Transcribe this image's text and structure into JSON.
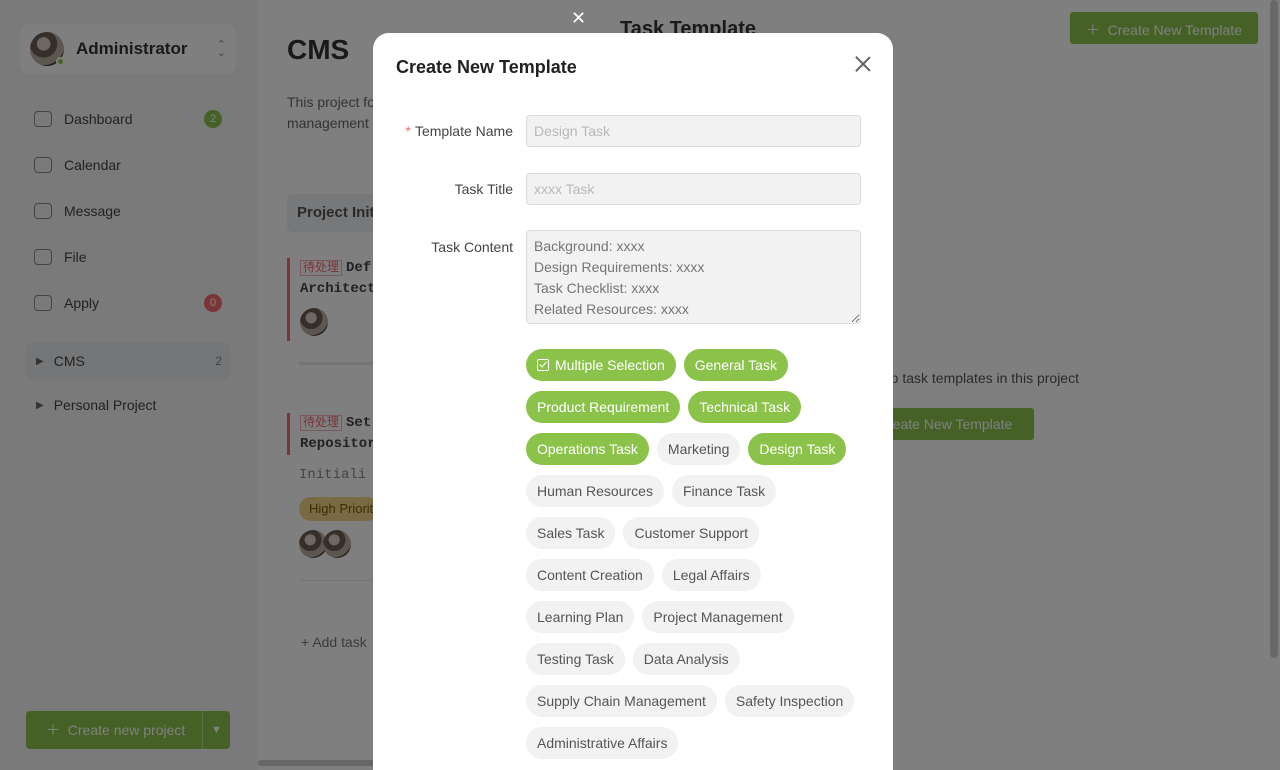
{
  "user": {
    "name": "Administrator"
  },
  "nav": [
    {
      "label": "Dashboard",
      "badge": "2",
      "badge_color": "green",
      "icon": "dashboard-icon"
    },
    {
      "label": "Calendar",
      "badge": "",
      "icon": "calendar-icon"
    },
    {
      "label": "Message",
      "badge": "",
      "icon": "message-icon"
    },
    {
      "label": "File",
      "badge": "",
      "icon": "file-icon"
    },
    {
      "label": "Apply",
      "badge": "0",
      "badge_color": "red",
      "icon": "apply-icon"
    }
  ],
  "projects": [
    {
      "label": "CMS",
      "count": "2"
    },
    {
      "label": "Personal Project",
      "count": ""
    }
  ],
  "create_project_label": "Create new project",
  "main": {
    "title": "CMS",
    "description_line1": "This project fo",
    "description_line2": "management ",
    "column_header": "Project Initi",
    "task1_tag": "待处理",
    "task1_line1": "Def",
    "task1_line2": "Architect",
    "task2_tag": "待处理",
    "task2_line1": "Set",
    "task2_line2": "Repositor",
    "task2_sub": "Initiali",
    "priority_label": "High Priorit",
    "add_task_label": "Add task"
  },
  "drawer": {
    "title": "Task Template",
    "create_top_label": "Create New Template",
    "empty_text": "y no task templates in this project",
    "create_mid_label": "reate New Template"
  },
  "modal": {
    "title": "Create New Template",
    "template_name_label": "Template Name",
    "template_name_placeholder": "Design Task",
    "task_title_label": "Task Title",
    "task_title_placeholder": "xxxx Task",
    "task_content_label": "Task Content",
    "task_content_placeholder": "Background: xxxx\nDesign Requirements: xxxx\nTask Checklist: xxxx\nRelated Resources: xxxx",
    "chips": [
      {
        "label": "Multiple Selection",
        "selected": true,
        "check": true
      },
      {
        "label": "General Task",
        "selected": true
      },
      {
        "label": "Product Requirement",
        "selected": true
      },
      {
        "label": "Technical Task",
        "selected": true
      },
      {
        "label": "Operations Task",
        "selected": true
      },
      {
        "label": "Marketing",
        "selected": false
      },
      {
        "label": "Design Task",
        "selected": true
      },
      {
        "label": "Human Resources",
        "selected": false
      },
      {
        "label": "Finance Task",
        "selected": false
      },
      {
        "label": "Sales Task",
        "selected": false
      },
      {
        "label": "Customer Support",
        "selected": false
      },
      {
        "label": "Content Creation",
        "selected": false
      },
      {
        "label": "Legal Affairs",
        "selected": false
      },
      {
        "label": "Learning Plan",
        "selected": false
      },
      {
        "label": "Project Management",
        "selected": false
      },
      {
        "label": "Testing Task",
        "selected": false
      },
      {
        "label": "Data Analysis",
        "selected": false
      },
      {
        "label": "Supply Chain Management",
        "selected": false
      },
      {
        "label": "Safety Inspection",
        "selected": false
      },
      {
        "label": "Administrative Affairs",
        "selected": false
      }
    ]
  },
  "colors": {
    "accent": "#8bc34a",
    "danger": "#f56c6c",
    "overlay": "rgba(0,0,0,0.5)"
  }
}
